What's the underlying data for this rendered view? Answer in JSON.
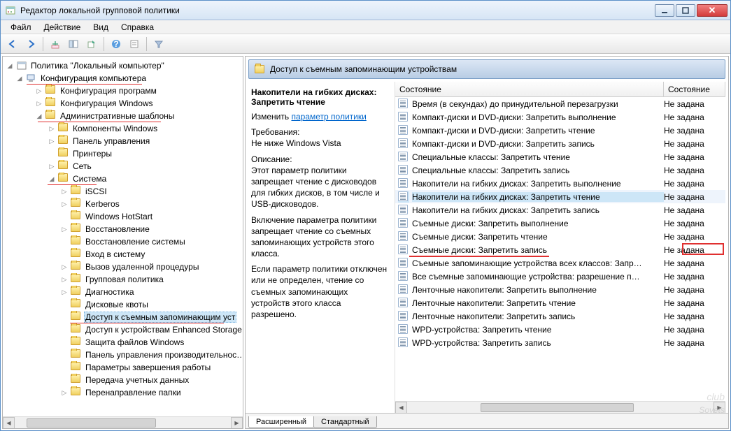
{
  "window": {
    "title": "Редактор локальной групповой политики"
  },
  "menu": {
    "file": "Файл",
    "action": "Действие",
    "view": "Вид",
    "help": "Справка"
  },
  "tree": {
    "root": "Политика \"Локальный компьютер\"",
    "comp_config": "Конфигурация компьютера",
    "prog_config": "Конфигурация программ",
    "win_config": "Конфигурация Windows",
    "admin_templates": "Административные шаблоны",
    "components": "Компоненты Windows",
    "control_panel": "Панель управления",
    "printers": "Принтеры",
    "network": "Сеть",
    "system": "Система",
    "sys_items": [
      "iSCSI",
      "Kerberos",
      "Windows HotStart",
      "Восстановление",
      "Восстановление системы",
      "Вход в систему",
      "Вызов удаленной процедуры",
      "Групповая политика",
      "Диагностика",
      "Дисковые квоты",
      "Доступ к съемным запоминающим уст",
      "Доступ к устройствам Enhanced Storage",
      "Защита файлов Windows",
      "Панель управления производительнос…",
      "Параметры завершения работы",
      "Передача учетных данных",
      "Перенаправление папки"
    ],
    "selected_index": 10
  },
  "right": {
    "path": "Доступ к съемным запоминающим устройствам",
    "detail": {
      "title": "Накопители на гибких дисках: Запретить чтение",
      "edit_label": "Изменить",
      "edit_link": "параметр политики",
      "req_label": "Требования:",
      "req_text": "Не ниже Windows Vista",
      "desc_label": "Описание:",
      "desc1": "Этот параметр политики запрещает чтение с дисководов для гибких дисков, в том числе и USB-дисководов.",
      "desc2": "Включение параметра политики запрещает чтение со съемных запоминающих устройств этого класса.",
      "desc3": "Если параметр политики отключен или не определен, чтение со съемных запоминающих устройств этого класса разрешено."
    },
    "columns": {
      "state_hdr": "Состояние",
      "state2": "Состояние"
    },
    "items": [
      {
        "name": "Время (в секундах) до принудительной перезагрузки",
        "state": "Не задана"
      },
      {
        "name": "Компакт-диски и DVD-диски: Запретить выполнение",
        "state": "Не задана"
      },
      {
        "name": "Компакт-диски и DVD-диски: Запретить чтение",
        "state": "Не задана"
      },
      {
        "name": "Компакт-диски и DVD-диски: Запретить запись",
        "state": "Не задана"
      },
      {
        "name": "Специальные классы: Запретить чтение",
        "state": "Не задана"
      },
      {
        "name": "Специальные классы: Запретить запись",
        "state": "Не задана"
      },
      {
        "name": "Накопители на гибких дисках: Запретить выполнение",
        "state": "Не задана"
      },
      {
        "name": "Накопители на гибких дисках: Запретить чтение",
        "state": "Не задана",
        "selected": true
      },
      {
        "name": "Накопители на гибких дисках: Запретить запись",
        "state": "Не задана"
      },
      {
        "name": "Съемные диски: Запретить выполнение",
        "state": "Не задана"
      },
      {
        "name": "Съемные диски: Запретить чтение",
        "state": "Не задана"
      },
      {
        "name": "Съемные диски: Запретить запись",
        "state": "Не задана",
        "red": true
      },
      {
        "name": "Съемные запоминающие устройства всех классов: Запр…",
        "state": "Не задана"
      },
      {
        "name": "Все съемные запоминающие устройства: разрешение п…",
        "state": "Не задана"
      },
      {
        "name": "Ленточные накопители: Запретить выполнение",
        "state": "Не задана"
      },
      {
        "name": "Ленточные накопители: Запретить чтение",
        "state": "Не задана"
      },
      {
        "name": "Ленточные накопители: Запретить запись",
        "state": "Не задана"
      },
      {
        "name": "WPD-устройства: Запретить чтение",
        "state": "Не задана"
      },
      {
        "name": "WPD-устройства: Запретить запись",
        "state": "Не задана"
      }
    ],
    "tabs": {
      "ext": "Расширенный",
      "std": "Стандартный"
    }
  },
  "watermark": {
    "top": "club",
    "bottom": "Sovets"
  }
}
